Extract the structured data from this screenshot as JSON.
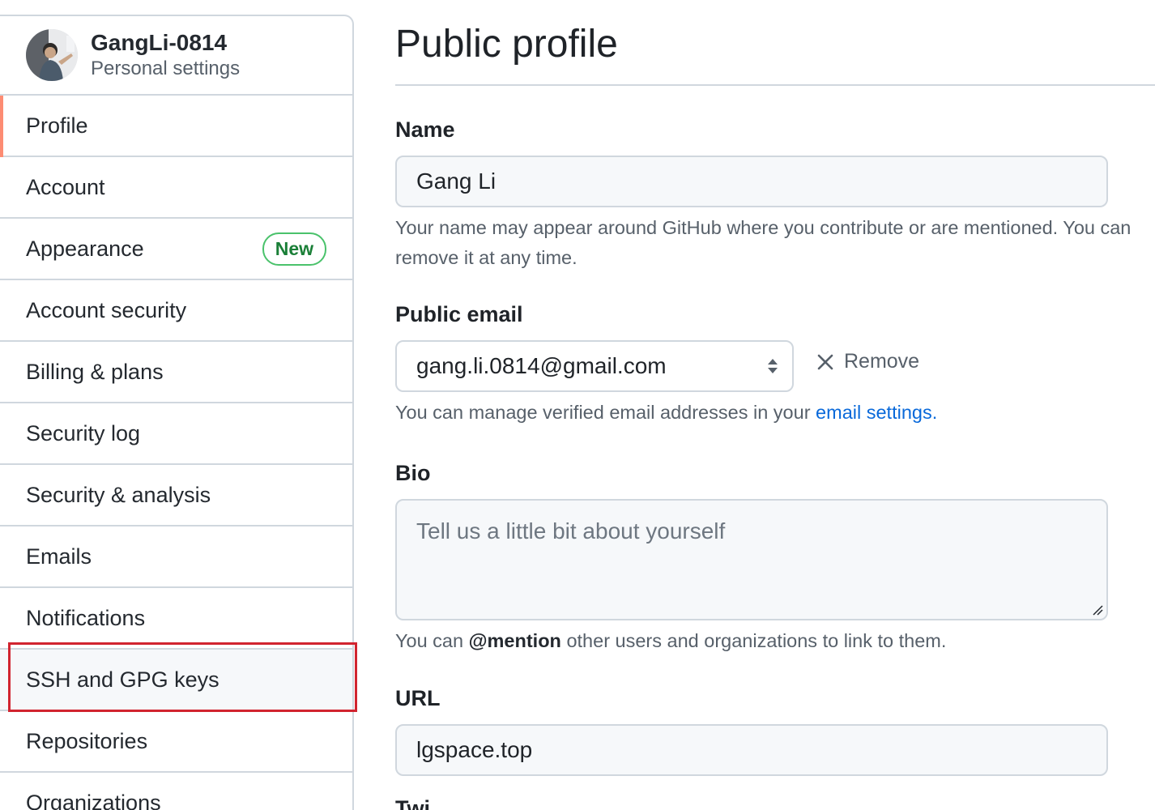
{
  "sidebar": {
    "user": {
      "name": "GangLi-0814",
      "subtitle": "Personal settings"
    },
    "items": [
      {
        "label": "Profile",
        "selected": true
      },
      {
        "label": "Account"
      },
      {
        "label": "Appearance",
        "badge": "New"
      },
      {
        "label": "Account security"
      },
      {
        "label": "Billing & plans"
      },
      {
        "label": "Security log"
      },
      {
        "label": "Security & analysis"
      },
      {
        "label": "Emails"
      },
      {
        "label": "Notifications"
      },
      {
        "label": "SSH and GPG keys",
        "highlighted": true
      },
      {
        "label": "Repositories"
      },
      {
        "label": "Organizations"
      }
    ]
  },
  "main": {
    "title": "Public profile",
    "name": {
      "label": "Name",
      "value": "Gang Li",
      "hint": "Your name may appear around GitHub where you contribute or are mentioned. You can remove it at any time."
    },
    "public_email": {
      "label": "Public email",
      "value": "gang.li.0814@gmail.com",
      "remove_label": "Remove",
      "hint_prefix": "You can manage verified email addresses in your ",
      "hint_link": "email settings",
      "hint_suffix": "."
    },
    "bio": {
      "label": "Bio",
      "placeholder": "Tell us a little bit about yourself",
      "hint_prefix": "You can ",
      "hint_bold": "@mention",
      "hint_suffix": " other users and organizations to link to them."
    },
    "url": {
      "label": "URL",
      "value": "lgspace.top"
    },
    "next_label_partial": "Twi"
  },
  "colors": {
    "selected_indicator": "#fd8c73",
    "badge_green": "#1a7f37",
    "link_blue": "#0969da",
    "highlight_outline": "#d1242f"
  },
  "icons": {
    "avatar": "user-photo-avatar",
    "select": "select-arrows-icon",
    "remove": "x-icon",
    "resize": "resize-grip-icon"
  }
}
